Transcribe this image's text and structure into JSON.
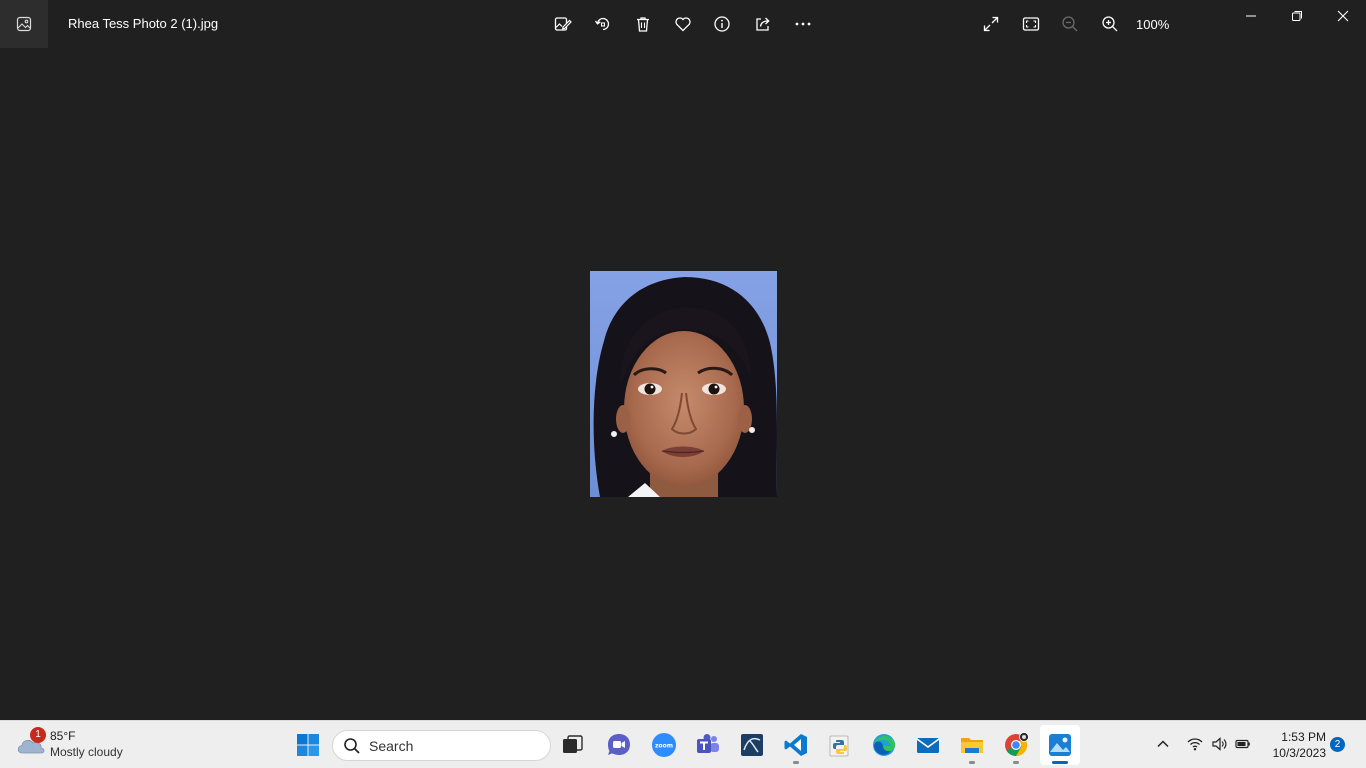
{
  "window": {
    "file_name": "Rhea Tess Photo 2 (1).jpg",
    "zoom_level": "100%",
    "toolbar_icons": [
      "edit-image-icon",
      "rotate-icon",
      "delete-icon",
      "favorite-icon",
      "info-icon",
      "share-icon",
      "more-icon",
      "fullscreen-icon",
      "fit-window-icon",
      "zoom-out-icon",
      "zoom-in-icon"
    ],
    "window_controls": [
      "minimize-icon",
      "restore-icon",
      "close-icon"
    ]
  },
  "viewer": {
    "photo_icon": "portrait-photo"
  },
  "taskbar": {
    "weather": {
      "badge": "1",
      "temperature": "85°F",
      "condition": "Mostly cloudy"
    },
    "search": {
      "placeholder": "Search"
    },
    "apps": [
      "task-view",
      "camera",
      "zoom",
      "teams",
      "sql",
      "vscode",
      "python",
      "edge",
      "mail",
      "file-explorer",
      "chrome",
      "photos"
    ],
    "clock": {
      "time": "1:53 PM",
      "date": "10/3/2023"
    },
    "notifications": "2"
  },
  "colors": {
    "background": "#202020",
    "taskbar": "#eeeeee",
    "accent": "#0067c0",
    "photo_background": "#7b9be0"
  }
}
